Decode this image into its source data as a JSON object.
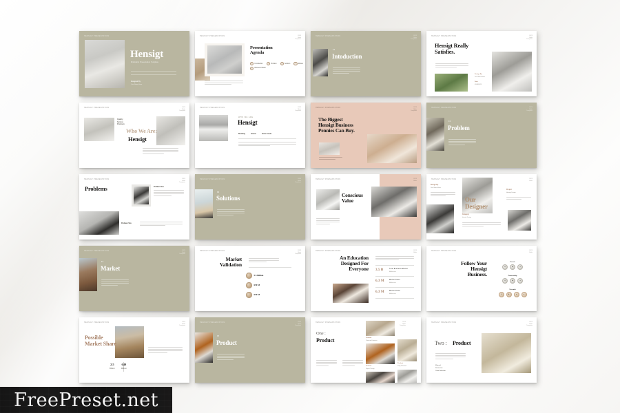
{
  "watermark": {
    "text": "FreePreset.net"
  },
  "brand": {
    "name": "Hensigt",
    "accent_tan": "#b9b6a0",
    "accent_blush": "#e8c9b9",
    "accent_brown": "#a9836a"
  },
  "common": {
    "header_mark": "Hensigt Presentation",
    "corner": [
      "2023",
      "Slide",
      "Template"
    ]
  },
  "slides": [
    {
      "id": "cover",
      "n": "01",
      "title": "Hensigt",
      "subtitle": "Minimalist Presentation Template",
      "footer_label": "Designed By",
      "footer_value": "Your Name Here",
      "theme": "tan"
    },
    {
      "id": "agenda",
      "n": "02",
      "title": "Presentation\nAgenda",
      "items": [
        "Introduction",
        "Problem",
        "Solution",
        "Market",
        "Business Model"
      ],
      "theme": "light"
    },
    {
      "id": "introduction",
      "n": "03",
      "eyebrow": "01",
      "title": "Intoduction",
      "theme": "tan"
    },
    {
      "id": "satisfies",
      "n": "04",
      "title": "Hensigt Really\nSatisfies.",
      "meta": [
        {
          "label": "Design By",
          "value": "Your Name Here"
        },
        {
          "label": "Date",
          "value": "01/08/2023"
        }
      ],
      "theme": "light"
    },
    {
      "id": "who-we-are",
      "n": "05",
      "kicker": "Who We Are:",
      "title": "Hensigt",
      "sidelabels": [
        "Quality",
        "Service",
        "Premium"
      ],
      "theme": "light"
    },
    {
      "id": "hensigt-tags",
      "n": "06",
      "kicker": "Who We Are",
      "title": "Hensigt",
      "tags": [
        "Branding",
        "Interior",
        "Home Goods"
      ],
      "theme": "light"
    },
    {
      "id": "biggest-business",
      "n": "07",
      "title": "The Biggest\nHensigt Business\nPennies Can Buy.",
      "theme": "blush"
    },
    {
      "id": "problem",
      "n": "08",
      "eyebrow": "02",
      "title": "Problem",
      "theme": "tan"
    },
    {
      "id": "problems",
      "n": "09",
      "title": "Problems",
      "items": [
        "Problem One",
        "Problem Two"
      ],
      "theme": "light"
    },
    {
      "id": "solutions",
      "n": "10",
      "eyebrow": "03",
      "title": "Solutions",
      "theme": "tan"
    },
    {
      "id": "conscious-value",
      "n": "11",
      "title": "Conscious\nValue",
      "theme": "light"
    },
    {
      "id": "our-designer",
      "n": "12",
      "title": "Our\nDesigner",
      "meta": [
        {
          "label": "Design By",
          "value": "Your Name Here"
        },
        {
          "label": "Project",
          "value": "Hensigt Design"
        },
        {
          "label": "Category",
          "value": "Interior Design"
        }
      ],
      "theme": "light"
    },
    {
      "id": "market",
      "n": "13",
      "eyebrow": "04",
      "title": "Market",
      "theme": "tan"
    },
    {
      "id": "market-validation",
      "n": "14",
      "title": "Market\nValidation",
      "stats": [
        "5.5 Billion",
        "650 M",
        "650 M"
      ],
      "theme": "light"
    },
    {
      "id": "education",
      "n": "15",
      "title": "An Education\nDesigned For\nEveryone",
      "stats": [
        {
          "value": "3.5 B",
          "label": "Total Available Market",
          "sub": "Market size"
        },
        {
          "value": "6.3 M",
          "label": "Market Share",
          "sub": "Market size"
        },
        {
          "value": "6.3 M",
          "label": "Market Niche",
          "sub": "Market size"
        }
      ],
      "theme": "light"
    },
    {
      "id": "follow",
      "n": "16",
      "title": "Follow Your\nHensigt\nBusiness.",
      "clusters": [
        {
          "title": "Events",
          "count": 3
        },
        {
          "title": "Partnership",
          "count": 3
        },
        {
          "title": "Network",
          "count": 4
        }
      ],
      "theme": "light"
    },
    {
      "id": "market-share",
      "n": "17",
      "title": "Possible\nMarket Share",
      "numbers": [
        {
          "value": "2.5",
          "label": "Billion"
        },
        {
          "value": "640",
          "label": "Million"
        }
      ],
      "theme": "light"
    },
    {
      "id": "product",
      "n": "18",
      "eyebrow": "05",
      "title": "Product",
      "theme": "tan"
    },
    {
      "id": "product-one",
      "n": "19",
      "prefix": "One :",
      "title": "Product",
      "meta": [
        {
          "label": "Product",
          "value": "Premium Furniture"
        },
        {
          "label": "Product",
          "value": "Object Theory"
        },
        {
          "label": "Product",
          "value": "Daily Selection"
        }
      ],
      "theme": "light"
    },
    {
      "id": "product-two",
      "n": "20",
      "prefix": "Two :",
      "title": "Product",
      "meta": [
        "Material",
        "Dimension",
        "Color Selection"
      ],
      "theme": "light"
    }
  ]
}
